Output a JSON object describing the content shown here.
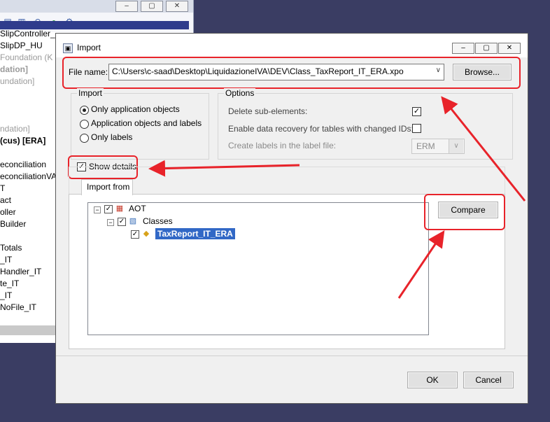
{
  "background": {
    "items": [
      {
        "text": "SlipController_",
        "style": "normal"
      },
      {
        "text": "SlipDP_HU",
        "style": "normal"
      },
      {
        "text": "Foundation (K",
        "style": "grey"
      },
      {
        "text": "dation]",
        "style": "grey-bold"
      },
      {
        "text": "undation]",
        "style": "grey"
      },
      {
        "text": "",
        "style": "normal"
      },
      {
        "text": "",
        "style": "normal"
      },
      {
        "text": "",
        "style": "normal"
      },
      {
        "text": "ndation]",
        "style": "grey"
      },
      {
        "text": "(cus)  [ERA]",
        "style": "bold"
      },
      {
        "text": "",
        "style": "normal"
      },
      {
        "text": "econciliation",
        "style": "normal"
      },
      {
        "text": "econciliationVA",
        "style": "normal"
      },
      {
        "text": "T",
        "style": "normal"
      },
      {
        "text": "act",
        "style": "normal"
      },
      {
        "text": "oller",
        "style": "normal"
      },
      {
        "text": "Builder",
        "style": "normal"
      },
      {
        "text": "",
        "style": "normal"
      },
      {
        "text": "Totals",
        "style": "normal"
      },
      {
        "text": "_IT",
        "style": "normal"
      },
      {
        "text": "Handler_IT",
        "style": "normal"
      },
      {
        "text": "te_IT",
        "style": "normal"
      },
      {
        "text": "_IT",
        "style": "normal"
      },
      {
        "text": "NoFile_IT",
        "style": "normal"
      }
    ]
  },
  "dialog": {
    "title": "Import",
    "file_name_label": "File name:",
    "file_name_value": "C:\\Users\\c-saad\\Desktop\\LiquidazioneIVA\\DEV\\Class_TaxReport_IT_ERA.xpo",
    "browse_label": "Browse...",
    "import_group": {
      "legend": "Import",
      "options": [
        {
          "label": "Only application objects",
          "selected": true
        },
        {
          "label": "Application objects and labels",
          "selected": false
        },
        {
          "label": "Only labels",
          "selected": false
        }
      ]
    },
    "options_group": {
      "legend": "Options",
      "delete_sub_elements": {
        "label": "Delete sub-elements:",
        "checked": true
      },
      "enable_recovery": {
        "label": "Enable data recovery for tables with changed IDs:",
        "checked": false
      },
      "create_labels": {
        "label": "Create labels in the label file:",
        "value": "ERM"
      }
    },
    "show_details": {
      "label": "Show details",
      "checked": true
    },
    "tab_label": "Import from",
    "tree": {
      "root": "AOT",
      "child": "Classes",
      "leaf": "TaxReport_IT_ERA"
    },
    "compare_label": "Compare",
    "ok_label": "OK",
    "cancel_label": "Cancel"
  },
  "colors": {
    "annotation": "#e8232a",
    "selection": "#3168c6"
  }
}
